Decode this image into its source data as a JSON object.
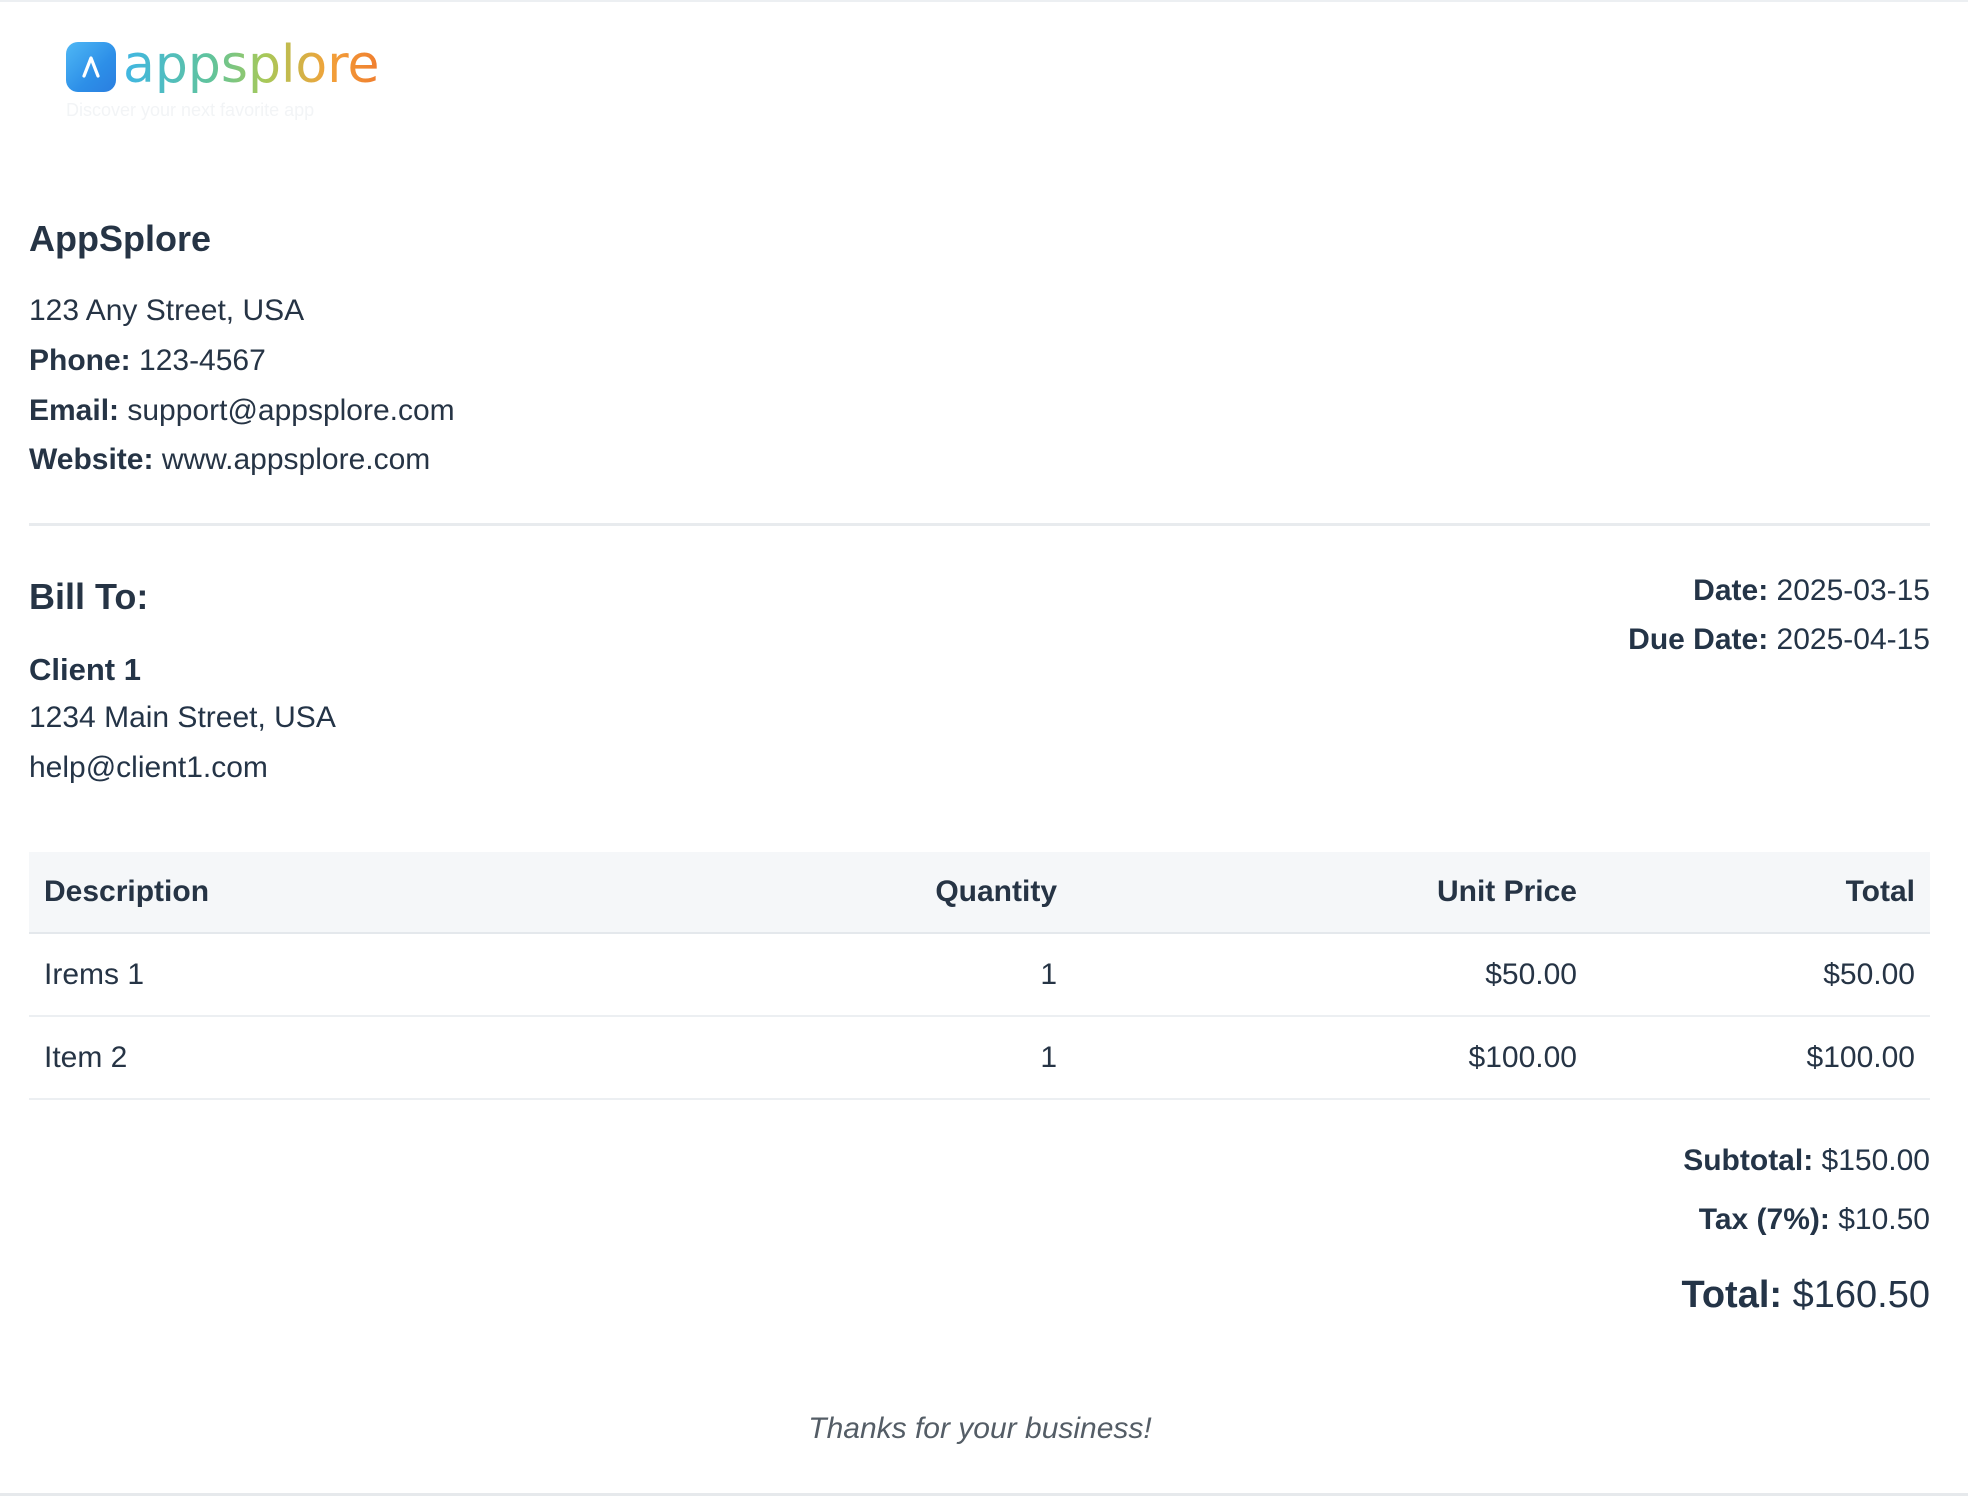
{
  "logo": {
    "wordmark": "appsplore",
    "tagline": "Discover your next favorite app",
    "icon": "appsplore-a-icon"
  },
  "company": {
    "name": "AppSplore",
    "address": "123 Any Street, USA",
    "phone_label": "Phone:",
    "phone": "123-4567",
    "email_label": "Email:",
    "email": "support@appsplore.com",
    "website_label": "Website:",
    "website": "www.appsplore.com"
  },
  "bill_to": {
    "heading": "Bill To:",
    "client_name": "Client 1",
    "client_address": "1234 Main Street, USA",
    "client_email": "help@client1.com"
  },
  "dates": {
    "date_label": "Date:",
    "date": "2025-03-15",
    "due_label": "Due Date:",
    "due": "2025-04-15"
  },
  "table": {
    "headers": [
      "Description",
      "Quantity",
      "Unit Price",
      "Total"
    ],
    "rows": [
      [
        "Irems 1",
        "1",
        "$50.00",
        "$50.00"
      ],
      [
        "Item 2",
        "1",
        "$100.00",
        "$100.00"
      ]
    ]
  },
  "totals": {
    "subtotal_label": "Subtotal:",
    "subtotal": "$150.00",
    "tax_label": "Tax (7%):",
    "tax": "$10.50",
    "total_label": "Total:",
    "total": "$160.50"
  },
  "footer": {
    "thanks": "Thanks for your business!"
  },
  "colors": {
    "text": "#263445",
    "table_header_bg": "#f5f7f9",
    "divider": "#e8ebee",
    "logo_blue": "#2d8fe8",
    "logo_orange": "#f07e2f"
  }
}
